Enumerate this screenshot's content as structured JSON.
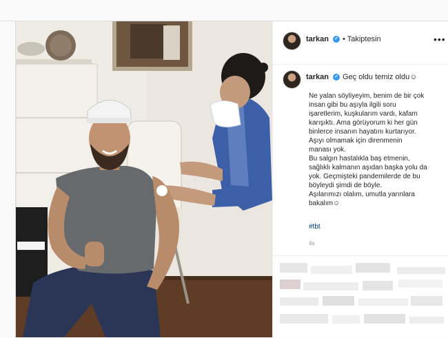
{
  "post": {
    "username": "tarkan",
    "follow_status": "• Takiptesin",
    "more_icon": "more-horizontal-icon",
    "caption_title": "Geç oldu temiz oldu☺",
    "caption_lines": [
      "Ne yalan söyliyeyim, benim de bir çok",
      "insan gibi bu aşıyla ilgili soru",
      "işaretlerim, kuşkularım vardı, kafam",
      "karışıktı. Ama görüyorum ki her gün",
      "binlerce insanın hayatını kurtarıyor.",
      "Aşıyı olmamak için direnmenin",
      "manası yok.",
      "Bu salgın hastalıkla baş etmenin,",
      "sağlıklı kalmanın aşıdan başka yolu da",
      "yok. Geçmişteki pandemilerde de bu",
      "böyleydi şimdi de böyle.",
      "Aşılarımızı olalım, umutla yarınlara",
      "bakalım☺"
    ],
    "hashtag": "#tbt",
    "timestamp": "4s"
  },
  "colors": {
    "verified_blue": "#3897f0",
    "hashtag_blue": "#00376b",
    "muted_gray": "#8e8e8e"
  }
}
